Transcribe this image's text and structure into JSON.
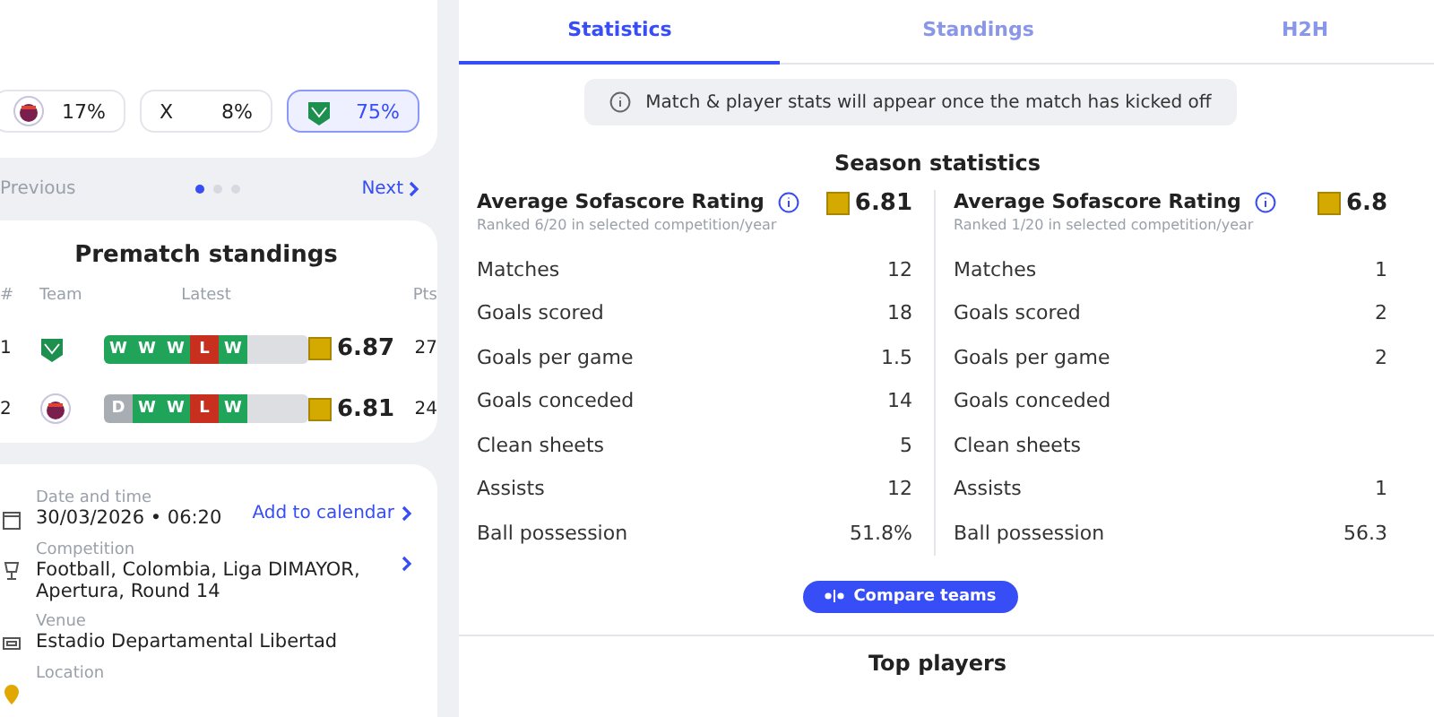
{
  "odds": [
    {
      "kind": "round",
      "value": "17%",
      "selected": false
    },
    {
      "kind": "text",
      "label": "X",
      "value": "8%",
      "selected": false
    },
    {
      "kind": "shield",
      "value": "75%",
      "selected": true
    }
  ],
  "pager": {
    "previous": "Previous",
    "next": "Next",
    "dots": [
      {
        "selected": true
      },
      {
        "selected": false
      },
      {
        "selected": false
      }
    ]
  },
  "standings": {
    "title": "Prematch standings",
    "columns": [
      "#",
      "Team",
      "Latest",
      "Pts"
    ],
    "rows": [
      {
        "rank": "1",
        "kind": "shield",
        "form": [
          {
            "kind": "win",
            "label": "W"
          },
          {
            "kind": "win",
            "label": "W"
          },
          {
            "kind": "win",
            "label": "W"
          },
          {
            "kind": "loss",
            "label": "L"
          },
          {
            "kind": "win",
            "label": "W"
          },
          {
            "kind": "empty"
          }
        ],
        "rating": "6.87",
        "pts": "27"
      },
      {
        "rank": "2",
        "kind": "round",
        "form": [
          {
            "kind": "draw",
            "label": "D"
          },
          {
            "kind": "win",
            "label": "W"
          },
          {
            "kind": "win",
            "label": "W"
          },
          {
            "kind": "loss",
            "label": "L"
          },
          {
            "kind": "win",
            "label": "W"
          },
          {
            "kind": "empty"
          }
        ],
        "rating": "6.81",
        "pts": "24"
      }
    ]
  },
  "details": [
    {
      "kind": "calendar",
      "label": "Date and time",
      "value": "30/03/2026 • 06:20",
      "action": "Add to calendar"
    },
    {
      "kind": "trophy",
      "label": "Competition",
      "value": "Football, Colombia, Liga DIMAYOR, Apertura, Round 14",
      "chevron": true
    },
    {
      "kind": "stadium",
      "label": "Venue",
      "value": "Estadio Departamental Libertad"
    },
    {
      "kind": "pin",
      "label": "Location"
    }
  ],
  "tabs": [
    {
      "label": "Statistics",
      "selected": true
    },
    {
      "label": "Standings",
      "selected": false
    },
    {
      "label": "H2H",
      "selected": false
    }
  ],
  "notice": "Match & player stats will appear once the match has kicked off",
  "season": {
    "title": "Season statistics",
    "teams": [
      {
        "rating_label": "Average Sofascore Rating",
        "rank": "Ranked 6/20 in selected competition/year",
        "rating": "6.81",
        "stats": [
          {
            "label": "Matches",
            "value": "12"
          },
          {
            "label": "Goals scored",
            "value": "18"
          },
          {
            "label": "Goals per game",
            "value": "1.5"
          },
          {
            "label": "Goals conceded",
            "value": "14"
          },
          {
            "label": "Clean sheets",
            "value": "5"
          },
          {
            "label": "Assists",
            "value": "12"
          },
          {
            "label": "Ball possession",
            "value": "51.8%"
          }
        ]
      },
      {
        "rating_label": "Average Sofascore Rating",
        "rank": "Ranked 1/20 in selected competition/year",
        "rating": "6.8",
        "stats": [
          {
            "label": "Matches",
            "value": "1"
          },
          {
            "label": "Goals scored",
            "value": "2"
          },
          {
            "label": "Goals per game",
            "value": "2"
          },
          {
            "label": "Goals conceded"
          },
          {
            "label": "Clean sheets"
          },
          {
            "label": "Assists",
            "value": "1"
          },
          {
            "label": "Ball possession",
            "value": "56.3"
          }
        ]
      }
    ]
  },
  "compare": "Compare teams",
  "top_players": "Top players"
}
